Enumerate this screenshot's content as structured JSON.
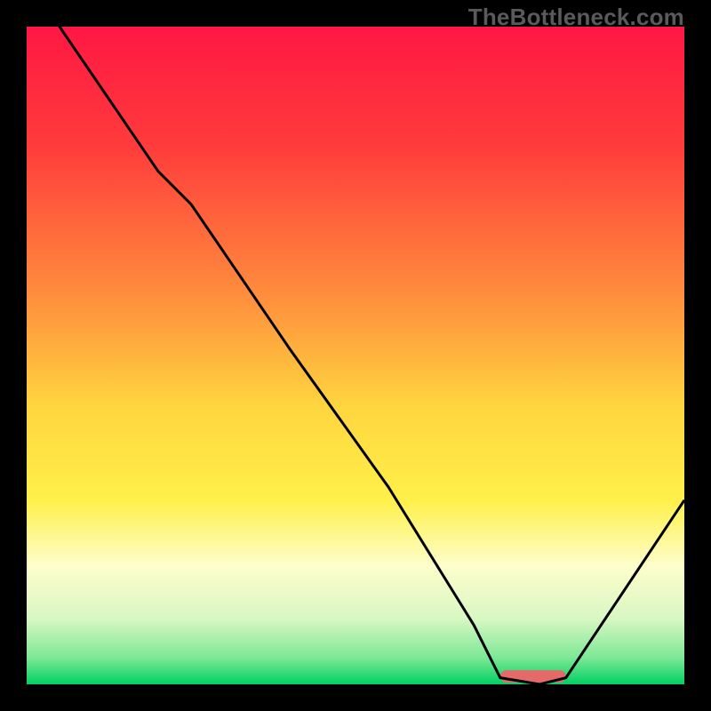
{
  "watermark": "TheBottleneck.com",
  "chart_data": {
    "type": "line",
    "title": "",
    "xlabel": "",
    "ylabel": "",
    "xlim": [
      0,
      100
    ],
    "ylim": [
      0,
      100
    ],
    "series": [
      {
        "name": "bottleneck-curve",
        "x": [
          0,
          5,
          20,
          25,
          40,
          55,
          68,
          72,
          78,
          82,
          100
        ],
        "y": [
          108,
          100,
          78,
          73,
          51,
          30,
          9,
          1,
          0,
          1,
          28
        ]
      }
    ],
    "highlight_segment": {
      "x_start": 72,
      "x_end": 82,
      "y": 1.2
    },
    "gradient_stops": [
      {
        "pct": 0,
        "color": "#ff1744"
      },
      {
        "pct": 18,
        "color": "#ff3b3b"
      },
      {
        "pct": 40,
        "color": "#ff8a3d"
      },
      {
        "pct": 58,
        "color": "#ffd63f"
      },
      {
        "pct": 72,
        "color": "#fff04a"
      },
      {
        "pct": 82,
        "color": "#fdfecb"
      },
      {
        "pct": 90,
        "color": "#d9f7c4"
      },
      {
        "pct": 96,
        "color": "#7ce895"
      },
      {
        "pct": 100,
        "color": "#00d061"
      }
    ],
    "colors": {
      "curve": "#000000",
      "highlight": "#e46a6a",
      "frame": "#000000"
    }
  }
}
